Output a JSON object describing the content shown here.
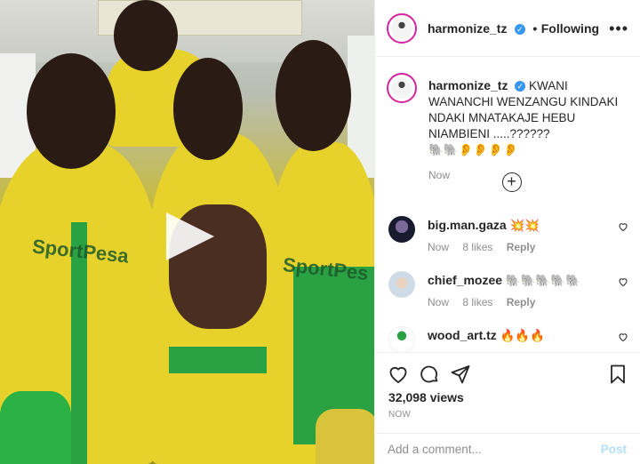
{
  "media": {
    "sponsor_left": "SportPesa",
    "sponsor_right": "SportPes"
  },
  "header": {
    "username": "harmonize_tz",
    "separator": "•",
    "follow_label": "Following",
    "more_label": "•••"
  },
  "caption": {
    "username": "harmonize_tz",
    "text": "KWANI WANANCHI WENZANGU KINDAKI NDAKI MNATAKAJE HEBU NIAMBIENI .....??????",
    "emojis": "🐘🐘👂👂👂👂",
    "time": "Now"
  },
  "load_more_symbol": "+",
  "comments": [
    {
      "username": "big.man.gaza",
      "text": "💥💥",
      "time": "Now",
      "likes": "8 likes",
      "reply": "Reply",
      "avatar_color": "#1a1a2e"
    },
    {
      "username": "chief_mozee",
      "text": "🐘🐘🐘🐘🐘",
      "time": "Now",
      "likes": "8 likes",
      "reply": "Reply",
      "avatar_color": "#d9e3ee"
    },
    {
      "username": "wood_art.tz",
      "text": "🔥🔥🔥",
      "time": "",
      "likes": "",
      "reply": "",
      "avatar_color": "#ffffff"
    }
  ],
  "actions": {
    "views": "32,098 views",
    "timestamp": "NOW"
  },
  "add_comment": {
    "placeholder": "Add a comment...",
    "post_label": "Post"
  },
  "colors": {
    "accent": "#3897f0",
    "post_disabled": "#b2dffc",
    "jersey_yellow": "#e6d22a",
    "jersey_green": "#2aa142"
  }
}
